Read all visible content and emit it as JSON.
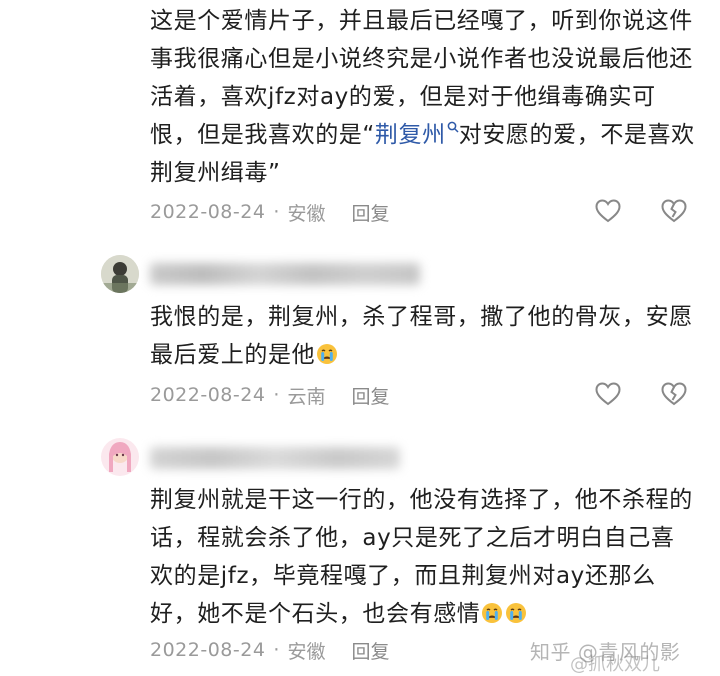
{
  "comments": [
    {
      "text_before_link": "这是个爱情片子，并且最后已经嘎了，听到你说这件事我很痛心但是小说终究是小说作者也没说最后他还活着，喜欢jfz对ay的爱，但是对于他缉毒确实可恨，但是我喜欢的是“",
      "link_text": "荆复州",
      "text_after_link": "对安愿的爱，不是喜欢荆复州缉毒”",
      "date": "2022-08-24",
      "location": "安徽",
      "reply_label": "回复"
    },
    {
      "text": "我恨的是，荆复州，杀了程哥，撒了他的骨灰，安愿最后爱上的是他",
      "date": "2022-08-24",
      "location": "云南",
      "reply_label": "回复"
    },
    {
      "text": "荆复州就是干这一行的，他没有选择了，他不杀程的话，程就会杀了他，ay只是死了之后才明白自己喜欢的是jfz，毕竟程嘎了，而且荆复州对ay还那么好，她不是个石头，也会有感情",
      "date": "2022-08-24",
      "location": "安徽",
      "reply_label": "回复"
    }
  ],
  "separator": "·",
  "icons": {
    "like": "heart-outline-icon",
    "dislike": "broken-heart-icon",
    "search": "search-icon",
    "emoji": "crying-face-emoji"
  },
  "colors": {
    "link": "#2f5aa8",
    "meta": "#9a9a9a",
    "text": "#1f1f1f"
  },
  "watermark": {
    "line1": "知乎 @青风的影",
    "line2": "@抓秋双儿"
  }
}
